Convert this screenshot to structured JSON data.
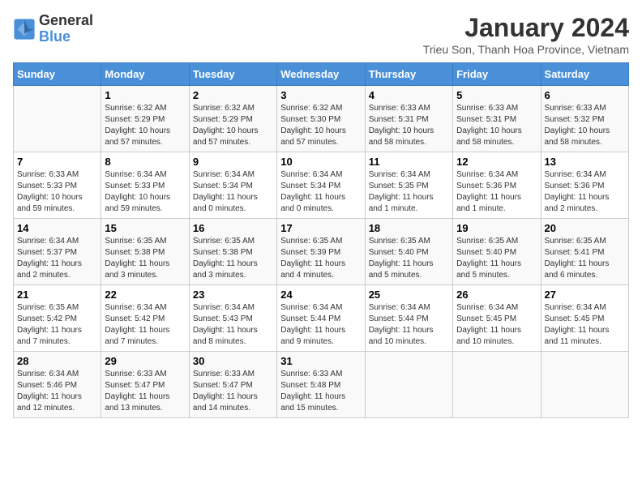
{
  "header": {
    "logo_general": "General",
    "logo_blue": "Blue",
    "month_title": "January 2024",
    "location": "Trieu Son, Thanh Hoa Province, Vietnam"
  },
  "days_of_week": [
    "Sunday",
    "Monday",
    "Tuesday",
    "Wednesday",
    "Thursday",
    "Friday",
    "Saturday"
  ],
  "weeks": [
    [
      {
        "day": "",
        "content": ""
      },
      {
        "day": "1",
        "content": "Sunrise: 6:32 AM\nSunset: 5:29 PM\nDaylight: 10 hours\nand 57 minutes."
      },
      {
        "day": "2",
        "content": "Sunrise: 6:32 AM\nSunset: 5:29 PM\nDaylight: 10 hours\nand 57 minutes."
      },
      {
        "day": "3",
        "content": "Sunrise: 6:32 AM\nSunset: 5:30 PM\nDaylight: 10 hours\nand 57 minutes."
      },
      {
        "day": "4",
        "content": "Sunrise: 6:33 AM\nSunset: 5:31 PM\nDaylight: 10 hours\nand 58 minutes."
      },
      {
        "day": "5",
        "content": "Sunrise: 6:33 AM\nSunset: 5:31 PM\nDaylight: 10 hours\nand 58 minutes."
      },
      {
        "day": "6",
        "content": "Sunrise: 6:33 AM\nSunset: 5:32 PM\nDaylight: 10 hours\nand 58 minutes."
      }
    ],
    [
      {
        "day": "7",
        "content": "Sunrise: 6:33 AM\nSunset: 5:33 PM\nDaylight: 10 hours\nand 59 minutes."
      },
      {
        "day": "8",
        "content": "Sunrise: 6:34 AM\nSunset: 5:33 PM\nDaylight: 10 hours\nand 59 minutes."
      },
      {
        "day": "9",
        "content": "Sunrise: 6:34 AM\nSunset: 5:34 PM\nDaylight: 11 hours\nand 0 minutes."
      },
      {
        "day": "10",
        "content": "Sunrise: 6:34 AM\nSunset: 5:34 PM\nDaylight: 11 hours\nand 0 minutes."
      },
      {
        "day": "11",
        "content": "Sunrise: 6:34 AM\nSunset: 5:35 PM\nDaylight: 11 hours\nand 1 minute."
      },
      {
        "day": "12",
        "content": "Sunrise: 6:34 AM\nSunset: 5:36 PM\nDaylight: 11 hours\nand 1 minute."
      },
      {
        "day": "13",
        "content": "Sunrise: 6:34 AM\nSunset: 5:36 PM\nDaylight: 11 hours\nand 2 minutes."
      }
    ],
    [
      {
        "day": "14",
        "content": "Sunrise: 6:34 AM\nSunset: 5:37 PM\nDaylight: 11 hours\nand 2 minutes."
      },
      {
        "day": "15",
        "content": "Sunrise: 6:35 AM\nSunset: 5:38 PM\nDaylight: 11 hours\nand 3 minutes."
      },
      {
        "day": "16",
        "content": "Sunrise: 6:35 AM\nSunset: 5:38 PM\nDaylight: 11 hours\nand 3 minutes."
      },
      {
        "day": "17",
        "content": "Sunrise: 6:35 AM\nSunset: 5:39 PM\nDaylight: 11 hours\nand 4 minutes."
      },
      {
        "day": "18",
        "content": "Sunrise: 6:35 AM\nSunset: 5:40 PM\nDaylight: 11 hours\nand 5 minutes."
      },
      {
        "day": "19",
        "content": "Sunrise: 6:35 AM\nSunset: 5:40 PM\nDaylight: 11 hours\nand 5 minutes."
      },
      {
        "day": "20",
        "content": "Sunrise: 6:35 AM\nSunset: 5:41 PM\nDaylight: 11 hours\nand 6 minutes."
      }
    ],
    [
      {
        "day": "21",
        "content": "Sunrise: 6:35 AM\nSunset: 5:42 PM\nDaylight: 11 hours\nand 7 minutes."
      },
      {
        "day": "22",
        "content": "Sunrise: 6:34 AM\nSunset: 5:42 PM\nDaylight: 11 hours\nand 7 minutes."
      },
      {
        "day": "23",
        "content": "Sunrise: 6:34 AM\nSunset: 5:43 PM\nDaylight: 11 hours\nand 8 minutes."
      },
      {
        "day": "24",
        "content": "Sunrise: 6:34 AM\nSunset: 5:44 PM\nDaylight: 11 hours\nand 9 minutes."
      },
      {
        "day": "25",
        "content": "Sunrise: 6:34 AM\nSunset: 5:44 PM\nDaylight: 11 hours\nand 10 minutes."
      },
      {
        "day": "26",
        "content": "Sunrise: 6:34 AM\nSunset: 5:45 PM\nDaylight: 11 hours\nand 10 minutes."
      },
      {
        "day": "27",
        "content": "Sunrise: 6:34 AM\nSunset: 5:45 PM\nDaylight: 11 hours\nand 11 minutes."
      }
    ],
    [
      {
        "day": "28",
        "content": "Sunrise: 6:34 AM\nSunset: 5:46 PM\nDaylight: 11 hours\nand 12 minutes."
      },
      {
        "day": "29",
        "content": "Sunrise: 6:33 AM\nSunset: 5:47 PM\nDaylight: 11 hours\nand 13 minutes."
      },
      {
        "day": "30",
        "content": "Sunrise: 6:33 AM\nSunset: 5:47 PM\nDaylight: 11 hours\nand 14 minutes."
      },
      {
        "day": "31",
        "content": "Sunrise: 6:33 AM\nSunset: 5:48 PM\nDaylight: 11 hours\nand 15 minutes."
      },
      {
        "day": "",
        "content": ""
      },
      {
        "day": "",
        "content": ""
      },
      {
        "day": "",
        "content": ""
      }
    ]
  ]
}
